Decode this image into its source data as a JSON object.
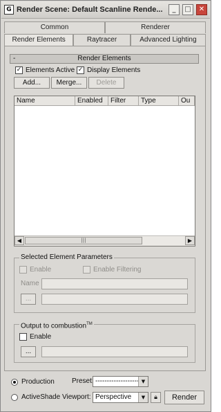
{
  "window": {
    "title": "Render Scene: Default Scanline Rende...",
    "app_icon": "max-logo-icon",
    "controls": [
      "minimize-icon",
      "maximize-icon",
      "close-icon"
    ]
  },
  "tabs": {
    "row1": [
      "Common",
      "Renderer"
    ],
    "row2": [
      "Render Elements",
      "Raytracer",
      "Advanced Lighting"
    ],
    "active": "Render Elements"
  },
  "rollout": {
    "sign": "-",
    "title": "Render Elements",
    "elements_active_label": "Elements Active",
    "elements_active_checked": true,
    "display_elements_label": "Display Elements",
    "display_elements_checked": true,
    "add_label": "Add...",
    "merge_label": "Merge...",
    "delete_label": "Delete",
    "list_columns": [
      "Name",
      "Enabled",
      "Filter",
      "Type",
      "Ou"
    ],
    "scroll_thumb": "|||"
  },
  "selected_params": {
    "title": "Selected Element Parameters",
    "enable_label": "Enable",
    "enable_filtering_label": "Enable Filtering",
    "name_label": "Name",
    "name_value": "",
    "browse_label": "...",
    "path_value": ""
  },
  "combustion": {
    "title": "Output to combustion",
    "tm": "TM",
    "enable_label": "Enable",
    "browse_label": "...",
    "path_value": ""
  },
  "bottom": {
    "production_label": "Production",
    "activeshade_label": "ActiveShade",
    "production_selected": true,
    "preset_label": "Preset:",
    "preset_value": "-------------------",
    "viewport_label": "Viewport:",
    "viewport_value": "Perspective",
    "render_label": "Render"
  }
}
